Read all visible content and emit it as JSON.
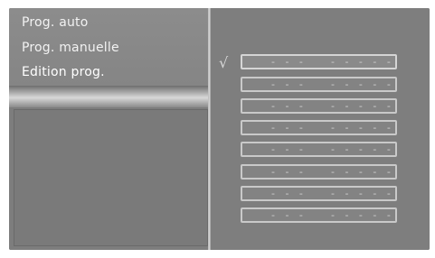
{
  "menu": {
    "items": [
      {
        "label": "Prog. auto"
      },
      {
        "label": "Prog. manuelle"
      },
      {
        "label": "Edition prog."
      }
    ]
  },
  "program_list": {
    "check_mark": "√",
    "slots": [
      {
        "number": "- - -",
        "name": "- - - - -",
        "selected": true
      },
      {
        "number": "- - -",
        "name": "- - - - -",
        "selected": false
      },
      {
        "number": "- - -",
        "name": "- - - - -",
        "selected": false
      },
      {
        "number": "- - -",
        "name": "- - - - -",
        "selected": false
      },
      {
        "number": "- - -",
        "name": "- - - - -",
        "selected": false
      },
      {
        "number": "- - -",
        "name": "- - - - -",
        "selected": false
      },
      {
        "number": "- - -",
        "name": "- - - - -",
        "selected": false
      },
      {
        "number": "- - -",
        "name": "- - - - -",
        "selected": false
      }
    ]
  }
}
